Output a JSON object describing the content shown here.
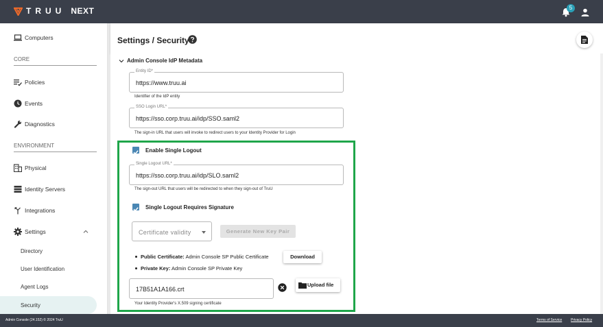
{
  "header": {
    "brand": "TRUU",
    "product": "NEXT",
    "notification_count": "5",
    "icons": [
      "truu-logo-icon",
      "bell-icon",
      "user-icon"
    ]
  },
  "sidebar": {
    "top_items": [
      {
        "label": "Computers",
        "icon": "laptop-icon"
      }
    ],
    "sections": [
      {
        "title": "CORE",
        "items": [
          {
            "label": "Policies",
            "icon": "policy-list-icon"
          },
          {
            "label": "Events",
            "icon": "clock-icon"
          },
          {
            "label": "Diagnostics",
            "icon": "wrench-icon"
          }
        ]
      },
      {
        "title": "ENVIRONMENT",
        "items": [
          {
            "label": "Physical",
            "icon": "building-icon"
          },
          {
            "label": "Identity Servers",
            "icon": "server-icon"
          },
          {
            "label": "Integrations",
            "icon": "merge-icon"
          },
          {
            "label": "Settings",
            "icon": "gear-icon",
            "expanded": true
          }
        ]
      }
    ],
    "settings_subitems": [
      "Directory",
      "User Identification",
      "Agent Logs",
      "Security"
    ],
    "active_subitem": "Security"
  },
  "page": {
    "title": "Settings / Security"
  },
  "idp_metadata": {
    "section_title": "Admin Console IdP Metadata",
    "entity_id": {
      "label": "Entity ID*",
      "value": "https://www.truu.ai",
      "helper": "Identifier of the IdP entity"
    },
    "sso_login_url": {
      "label": "SSO Login URL*",
      "value": "https://sso.corp.truu.ai/idp/SSO.saml2",
      "helper": "The sign-in URL that users will invoke to redirect users to your Identity Provider for Login"
    },
    "enable_single_logout": {
      "label": "Enable Single Logout",
      "checked": true
    },
    "single_logout_url": {
      "label": "Single Logout URL*",
      "value": "https://sso.corp.truu.ai/idp/SLO.saml2",
      "helper": "The sign-out URL that users will be redirected to when they sign-out of TruU"
    },
    "logout_requires_signature": {
      "label": "Single Logout Requires Signature",
      "checked": true
    },
    "certificate_validity": {
      "placeholder": "Certificate validity"
    },
    "generate_button": "Generate New Key Pair",
    "public_certificate": {
      "label": "Public Certificate:",
      "value": "Admin Console SP Public Certificate"
    },
    "private_key": {
      "label": "Private Key:",
      "value": "Admin Console SP Private Key"
    },
    "download_button": "Download",
    "upload": {
      "file_name": "17B51A1A166.crt",
      "button": "Upload file",
      "helper": "Your Identity Provider's X.509 signing certificate"
    },
    "highlight_color": "#1fa64a"
  },
  "footer": {
    "version": "Admin Console (24.152) © 2024 TruU",
    "terms": "Terms of Service",
    "privacy": "Privacy Policy"
  },
  "colors": {
    "topbar": "#3a3f4a",
    "checkbox": "#4a87b4",
    "badge": "#2aa0b7",
    "active_nav": "#e6f2f2"
  }
}
